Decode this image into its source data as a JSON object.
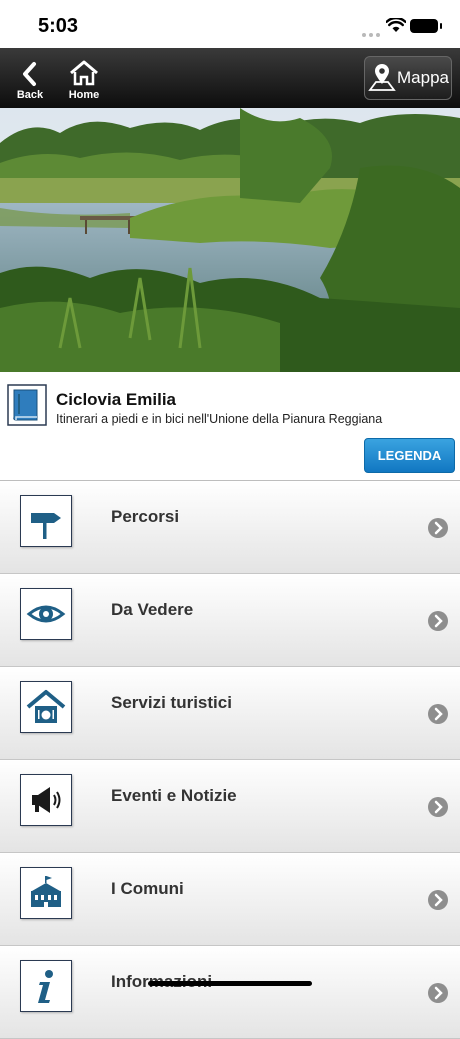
{
  "status": {
    "time": "5:03"
  },
  "navbar": {
    "back_label": "Back",
    "home_label": "Home",
    "map_label": "Mappa"
  },
  "header": {
    "title": "Ciclovia Emilia",
    "subtitle": "Itinerari a piedi e in bici nell'Unione della Pianura Reggiana",
    "legend_button": "LEGENDA"
  },
  "menu": {
    "items": [
      {
        "label": "Percorsi",
        "icon": "signpost-icon"
      },
      {
        "label": "Da Vedere",
        "icon": "eye-icon"
      },
      {
        "label": "Servizi turistici",
        "icon": "house-dining-icon"
      },
      {
        "label": "Eventi e Notizie",
        "icon": "megaphone-icon"
      },
      {
        "label": "I Comuni",
        "icon": "town-hall-icon"
      },
      {
        "label": "Informazioni",
        "icon": "info-icon"
      }
    ]
  },
  "colors": {
    "accent": "#1a85cf",
    "icon_stroke": "#2b3a52",
    "icon_fill": "#1f5f86"
  }
}
